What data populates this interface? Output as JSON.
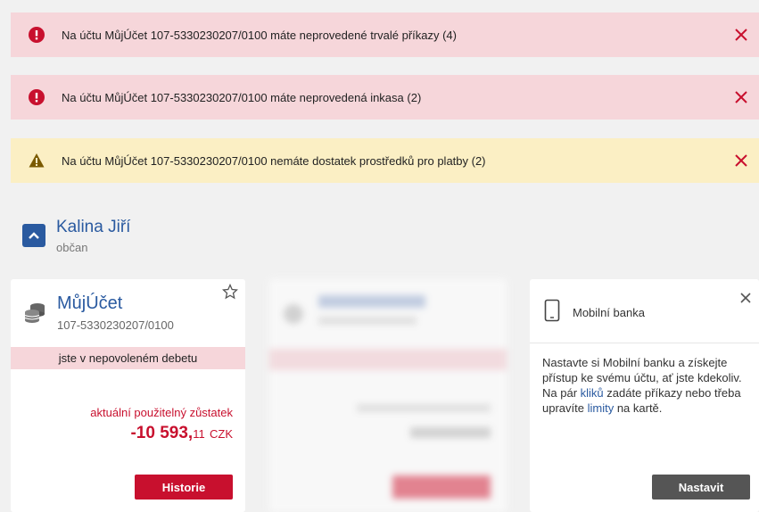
{
  "colors": {
    "error_bg": "#f6d6da",
    "warning_bg": "#fbefc4",
    "accent_red": "#c8102e",
    "brand_blue": "#2a5aa0"
  },
  "alerts": [
    {
      "type": "error",
      "icon": "exclamation-circle-icon",
      "text": "Na účtu MůjÚčet 107-5330230207/0100 máte neprovedené trvalé příkazy (4)"
    },
    {
      "type": "error",
      "icon": "exclamation-circle-icon",
      "text": "Na účtu MůjÚčet 107-5330230207/0100 máte neprovedená inkasa (2)"
    },
    {
      "type": "warning",
      "icon": "warning-triangle-icon",
      "text": "Na účtu MůjÚčet 107-5330230207/0100 nemáte dostatek prostředků pro platby (2)"
    }
  ],
  "owner": {
    "name": "Kalina Jiří",
    "role": "občan"
  },
  "account": {
    "name": "MůjÚčet",
    "number": "107-5330230207/0100",
    "status": "jste v nepovoleném debetu",
    "balance_label": "aktuální použitelný zůstatek",
    "balance_main": "-10 593,",
    "balance_cents": "11",
    "currency": "CZK",
    "history_button": "Historie"
  },
  "mobile_bank": {
    "title": "Mobilní banka",
    "text_1": "Nastavte si Mobilní banku a získejte přístup ke svému účtu, ať jste kdekoliv. Na pár ",
    "link_1": "kliků",
    "text_2": " zadáte příkazy nebo třeba upravíte ",
    "link_2": "limity",
    "text_3": " na kartě.",
    "button": "Nastavit"
  }
}
